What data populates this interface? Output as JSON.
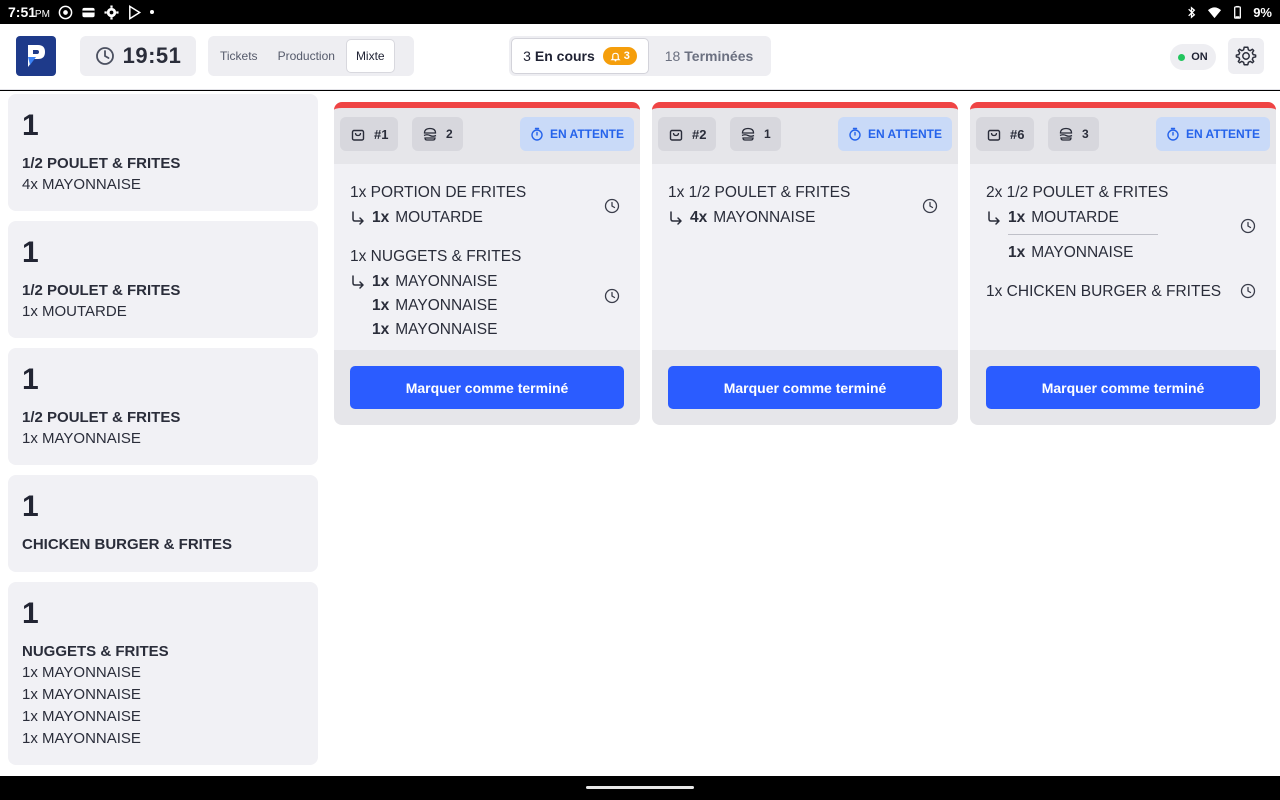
{
  "statusbar": {
    "time": "7:51",
    "ampm": "PM",
    "battery": "9%"
  },
  "header": {
    "clock": "19:51",
    "modes": [
      "Tickets",
      "Production",
      "Mixte"
    ],
    "active_mode": "Mixte",
    "filter": {
      "in_progress_count": "3",
      "in_progress_label": "En cours",
      "alert_count": "3",
      "done_count": "18",
      "done_label": "Terminées"
    },
    "online_label": "ON",
    "colors": {
      "accent": "#2b5cff",
      "online": "#22c55e",
      "alert": "#f59e0b",
      "urgent": "#ef4444"
    }
  },
  "sidebar": {
    "items": [
      {
        "qty": "1",
        "name": "1/2 POULET & FRITES",
        "options": [
          "4x MAYONNAISE"
        ]
      },
      {
        "qty": "1",
        "name": "1/2 POULET & FRITES",
        "options": [
          "1x MOUTARDE"
        ]
      },
      {
        "qty": "1",
        "name": "1/2 POULET & FRITES",
        "options": [
          "1x MAYONNAISE"
        ]
      },
      {
        "qty": "1",
        "name": "CHICKEN BURGER & FRITES",
        "options": []
      },
      {
        "qty": "1",
        "name": "NUGGETS & FRITES",
        "options": [
          "1x MAYONNAISE",
          "1x MAYONNAISE",
          "1x MAYONNAISE",
          "1x MAYONNAISE"
        ]
      }
    ]
  },
  "tickets": [
    {
      "number": "#1",
      "covers": "2",
      "status": "EN ATTENTE",
      "lines": [
        {
          "main": "1x PORTION DE FRITES",
          "subs": [
            {
              "qty": "1x",
              "name": "MOUTARDE"
            }
          ]
        },
        {
          "main": "1x NUGGETS & FRITES",
          "subs": [
            {
              "qty": "1x",
              "name": "MAYONNAISE"
            },
            {
              "qty": "1x",
              "name": "MAYONNAISE"
            },
            {
              "qty": "1x",
              "name": "MAYONNAISE"
            }
          ]
        }
      ],
      "button": "Marquer comme terminé"
    },
    {
      "number": "#2",
      "covers": "1",
      "status": "EN ATTENTE",
      "lines": [
        {
          "main": "1x 1/2 POULET & FRITES",
          "subs": [
            {
              "qty": "4x",
              "name": "MAYONNAISE"
            }
          ]
        }
      ],
      "button": "Marquer comme terminé"
    },
    {
      "number": "#6",
      "covers": "3",
      "status": "EN ATTENTE",
      "lines": [
        {
          "main": "2x 1/2 POULET & FRITES",
          "subs": [
            {
              "qty": "1x",
              "name": "MOUTARDE"
            },
            {
              "qty": "1x",
              "name": "MAYONNAISE"
            }
          ]
        },
        {
          "main": "1x CHICKEN BURGER & FRITES",
          "subs": []
        }
      ],
      "button": "Marquer comme terminé"
    }
  ]
}
